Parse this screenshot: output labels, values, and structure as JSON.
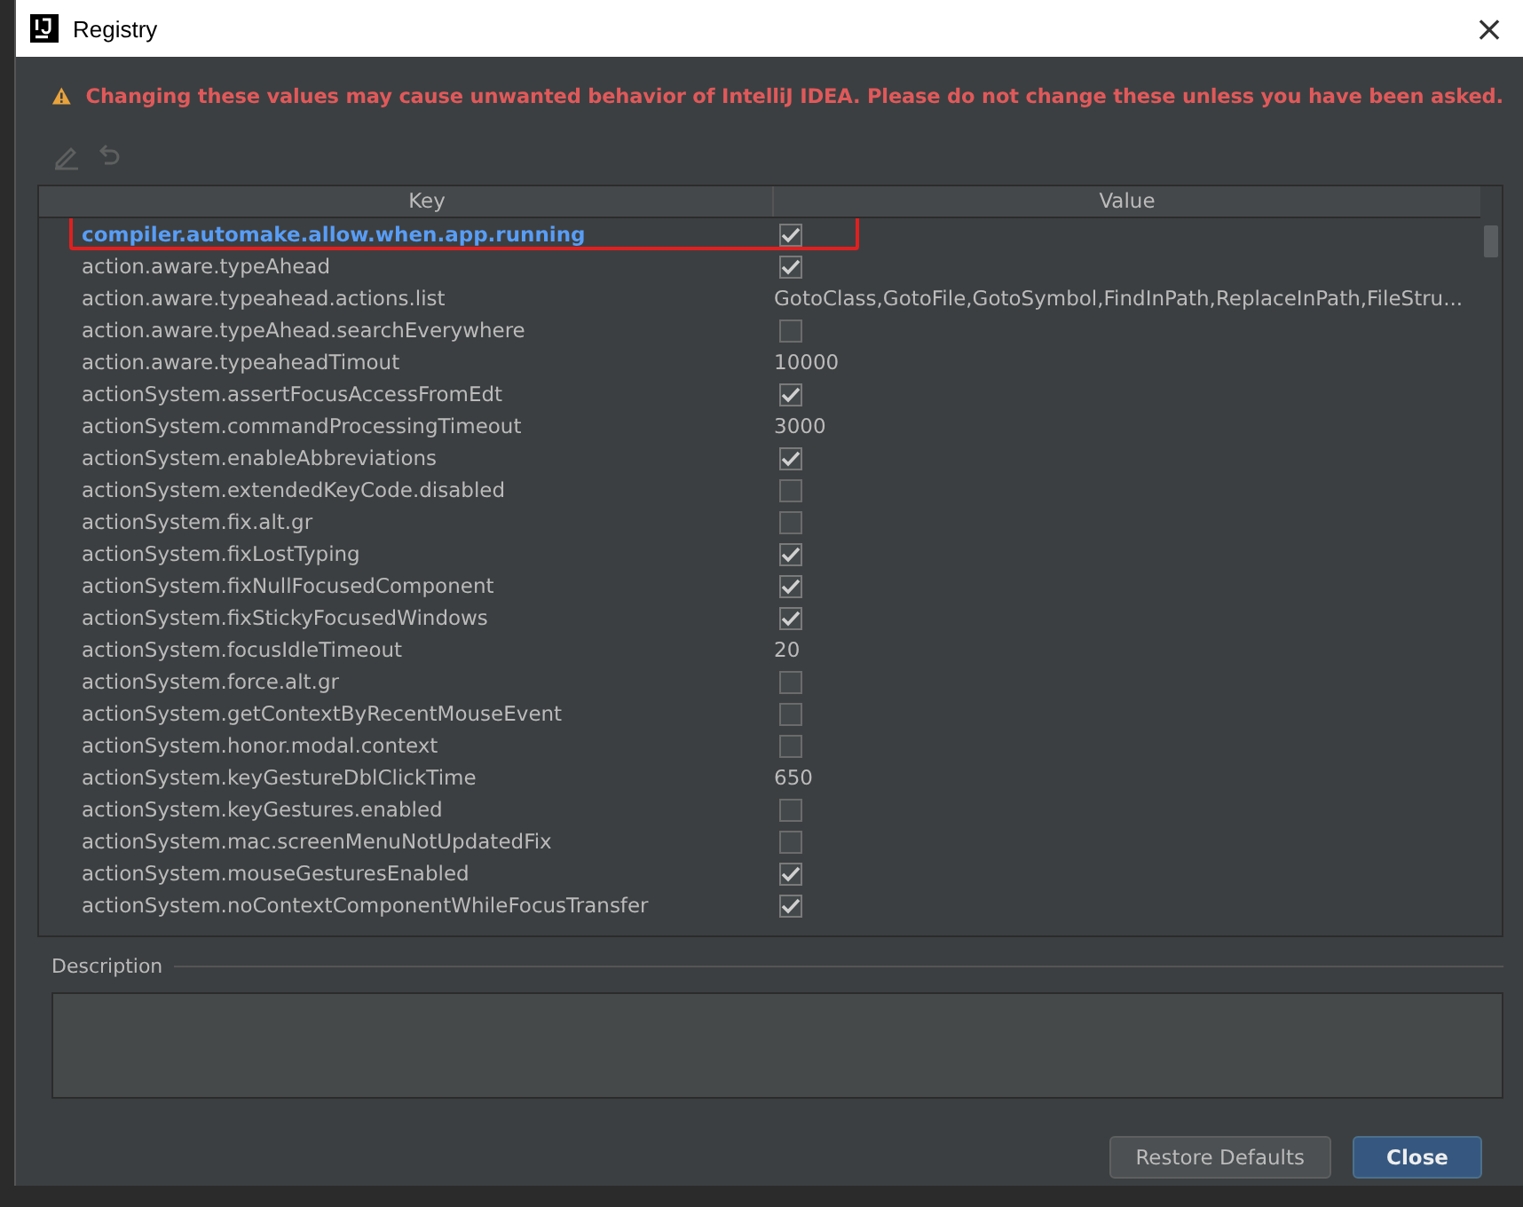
{
  "window": {
    "title": "Registry",
    "close": "×"
  },
  "warning": "Changing these values may cause unwanted behavior of IntelliJ IDEA. Please do not change these unless you have been asked.",
  "toolbar": [
    {
      "kind": "edit",
      "disabled": true
    },
    {
      "kind": "revert",
      "disabled": true
    }
  ],
  "table": {
    "columns": [
      "Key",
      "Value"
    ],
    "rows": [
      {
        "key": "compiler.automake.allow.when.app.running",
        "selected": true,
        "annotated": true,
        "kind": "checkbox",
        "checked": true
      },
      {
        "key": "action.aware.typeAhead",
        "selected": false,
        "annotated": false,
        "kind": "checkbox",
        "checked": true
      },
      {
        "key": "action.aware.typeahead.actions.list",
        "selected": false,
        "annotated": false,
        "kind": "text",
        "value": "GotoClass,GotoFile,GotoSymbol,FindInPath,ReplaceInPath,FileStru..."
      },
      {
        "key": "action.aware.typeAhead.searchEverywhere",
        "selected": false,
        "annotated": false,
        "kind": "checkbox",
        "checked": false
      },
      {
        "key": "action.aware.typeaheadTimout",
        "selected": false,
        "annotated": false,
        "kind": "text",
        "value": "10000"
      },
      {
        "key": "actionSystem.assertFocusAccessFromEdt",
        "selected": false,
        "annotated": false,
        "kind": "checkbox",
        "checked": true
      },
      {
        "key": "actionSystem.commandProcessingTimeout",
        "selected": false,
        "annotated": false,
        "kind": "text",
        "value": "3000"
      },
      {
        "key": "actionSystem.enableAbbreviations",
        "selected": false,
        "annotated": false,
        "kind": "checkbox",
        "checked": true
      },
      {
        "key": "actionSystem.extendedKeyCode.disabled",
        "selected": false,
        "annotated": false,
        "kind": "checkbox",
        "checked": false
      },
      {
        "key": "actionSystem.fix.alt.gr",
        "selected": false,
        "annotated": false,
        "kind": "checkbox",
        "checked": false
      },
      {
        "key": "actionSystem.fixLostTyping",
        "selected": false,
        "annotated": false,
        "kind": "checkbox",
        "checked": true
      },
      {
        "key": "actionSystem.fixNullFocusedComponent",
        "selected": false,
        "annotated": false,
        "kind": "checkbox",
        "checked": true
      },
      {
        "key": "actionSystem.fixStickyFocusedWindows",
        "selected": false,
        "annotated": false,
        "kind": "checkbox",
        "checked": true
      },
      {
        "key": "actionSystem.focusIdleTimeout",
        "selected": false,
        "annotated": false,
        "kind": "text",
        "value": "20"
      },
      {
        "key": "actionSystem.force.alt.gr",
        "selected": false,
        "annotated": false,
        "kind": "checkbox",
        "checked": false
      },
      {
        "key": "actionSystem.getContextByRecentMouseEvent",
        "selected": false,
        "annotated": false,
        "kind": "checkbox",
        "checked": false
      },
      {
        "key": "actionSystem.honor.modal.context",
        "selected": false,
        "annotated": false,
        "kind": "checkbox",
        "checked": false
      },
      {
        "key": "actionSystem.keyGestureDblClickTime",
        "selected": false,
        "annotated": false,
        "kind": "text",
        "value": "650"
      },
      {
        "key": "actionSystem.keyGestures.enabled",
        "selected": false,
        "annotated": false,
        "kind": "checkbox",
        "checked": false
      },
      {
        "key": "actionSystem.mac.screenMenuNotUpdatedFix",
        "selected": false,
        "annotated": false,
        "kind": "checkbox",
        "checked": false
      },
      {
        "key": "actionSystem.mouseGesturesEnabled",
        "selected": false,
        "annotated": false,
        "kind": "checkbox",
        "checked": true
      },
      {
        "key": "actionSystem.noContextComponentWhileFocusTransfer",
        "selected": false,
        "annotated": false,
        "kind": "checkbox",
        "checked": true
      }
    ]
  },
  "description": {
    "label": "Description"
  },
  "buttons": [
    {
      "label": "Restore Defaults",
      "default": false
    },
    {
      "label": "Close",
      "default": true
    }
  ]
}
